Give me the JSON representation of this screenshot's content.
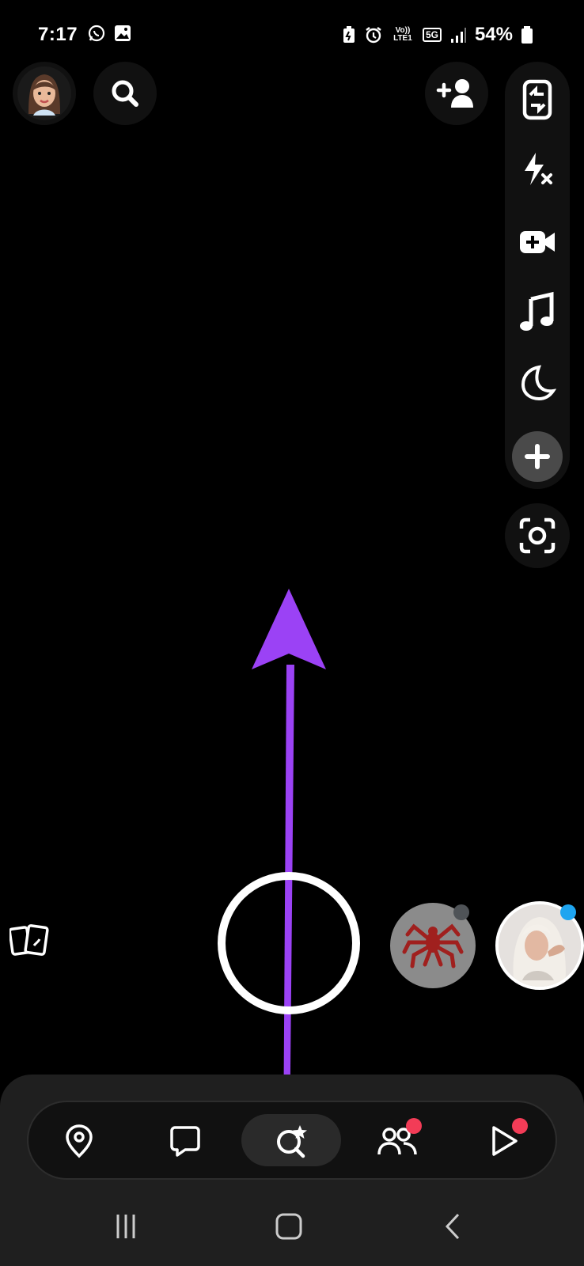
{
  "status_bar": {
    "time": "7:17",
    "left_icons": [
      "whatsapp-icon",
      "gallery-icon"
    ],
    "volte": "Vo)) LTE1",
    "network": "5G",
    "battery": "54%",
    "right_icons": [
      "battery-saver-icon",
      "alarm-icon",
      "signal-icon",
      "battery-icon"
    ]
  },
  "top_bar": {
    "left_icons": [
      "bitmoji-avatar",
      "search-icon"
    ],
    "right_icons": [
      "add-friend-icon"
    ]
  },
  "camera_tools": [
    "flip-camera-icon",
    "flash-off-icon",
    "video-effects-icon",
    "music-icon",
    "night-mode-icon",
    "plus-icon"
  ],
  "scan_button": "scan-icon",
  "overlay_arrow": {
    "color": "#9b42f5"
  },
  "lenses": [
    {
      "name": "spider-lens",
      "dot_color": "#4f5357"
    },
    {
      "name": "portrait-lens",
      "dot_color": "#1ea5f0"
    }
  ],
  "memories_icon": "memories-icon",
  "nav": {
    "items": [
      "map-icon",
      "chat-icon",
      "camera-lens-icon",
      "friends-icon",
      "stories-play-icon"
    ],
    "active": "camera-lens-icon",
    "badge_color": "#f23c57"
  },
  "system_nav": [
    "recent-apps-icon",
    "home-icon",
    "back-icon"
  ]
}
